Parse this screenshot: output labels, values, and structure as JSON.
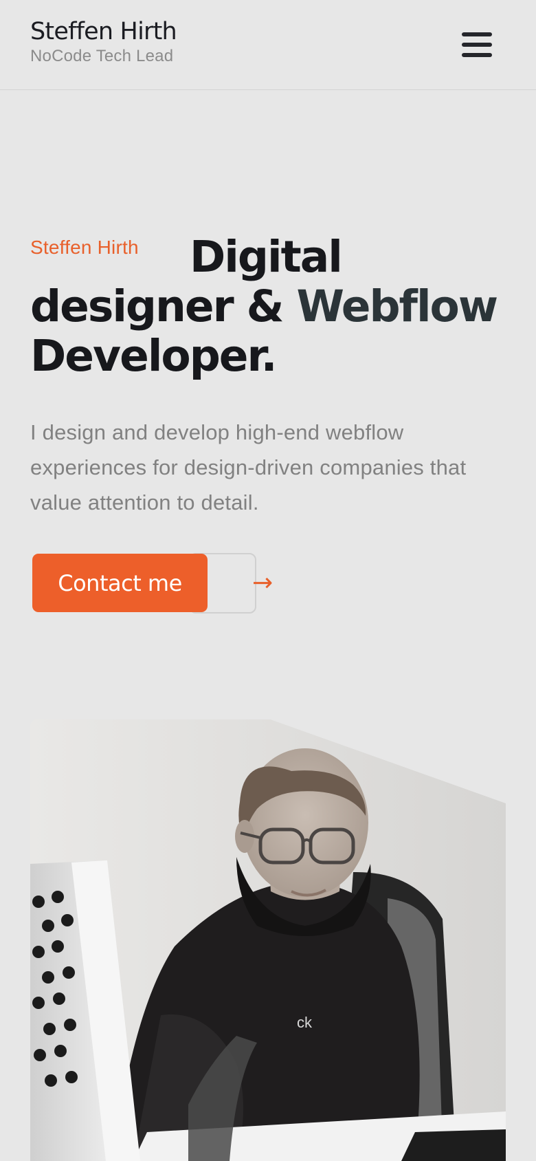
{
  "header": {
    "brand_name": "Steffen Hirth",
    "brand_role": "NoCode Tech Lead",
    "menu_icon": "hamburger-menu-icon"
  },
  "hero": {
    "eyebrow": "Steffen Hirth",
    "headline_part1": "Digital designer & ",
    "headline_part2": "Webflow",
    "headline_part3": " Developer.",
    "lead": "I design and develop high-end webflow experiences for design-driven companies that value attention to detail."
  },
  "cta": {
    "label": "Contact me",
    "arrow_icon": "arrow-right-icon",
    "arrow_glyph": "→"
  },
  "portrait": {
    "alt": "Steffen Hirth at desk",
    "logo_text": "ck"
  },
  "colors": {
    "background": "#e7e7e7",
    "accent": "#ed5f2a",
    "text_dark": "#17181c",
    "text_muted": "#818181"
  }
}
